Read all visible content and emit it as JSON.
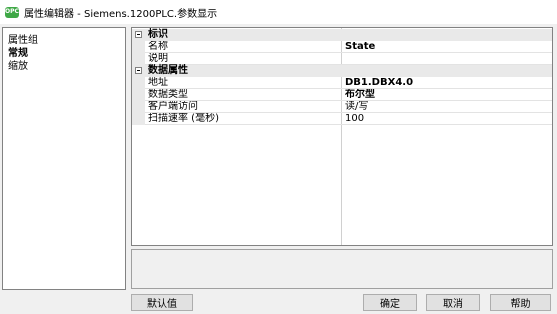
{
  "window": {
    "title": "属性编辑器 - Siemens.1200PLC.参数显示",
    "icon_text": "OPC",
    "icon_color": "#3fa846"
  },
  "left_panel": {
    "title": "属性组",
    "items": [
      {
        "label": "常规",
        "selected": true
      },
      {
        "label": "缩放",
        "selected": false
      }
    ]
  },
  "property_grid": {
    "categories": [
      {
        "label": "标识",
        "properties": [
          {
            "name": "名称",
            "value": "State",
            "bold": true
          },
          {
            "name": "说明",
            "value": "",
            "bold": false
          }
        ]
      },
      {
        "label": "数据属性",
        "properties": [
          {
            "name": "地址",
            "value": "DB1.DBX4.0",
            "bold": true
          },
          {
            "name": "数据类型",
            "value": "布尔型",
            "bold": true
          },
          {
            "name": "客户端访问",
            "value": "读/写",
            "bold": false
          },
          {
            "name": "扫描速率 (毫秒)",
            "value": "100",
            "bold": false
          }
        ]
      }
    ]
  },
  "buttons": {
    "default": "默认值",
    "ok": "确定",
    "cancel": "取消",
    "help": "帮助"
  }
}
